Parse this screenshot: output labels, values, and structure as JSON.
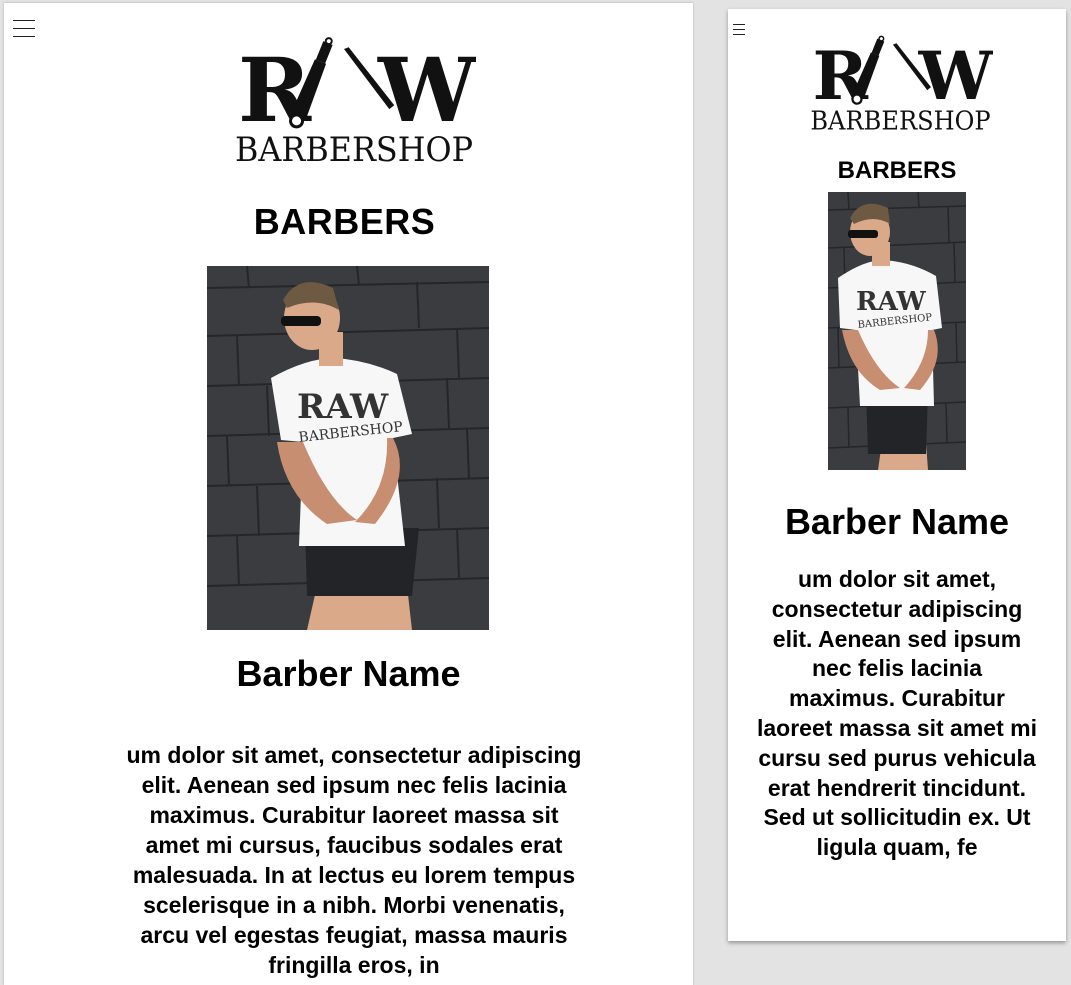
{
  "large_view": {
    "logo": {
      "text_main": "RAW",
      "text_sub": "BARBERSHOP"
    },
    "section_title": "BARBERS",
    "barber": {
      "name": "Barber Name",
      "bio": "um dolor sit amet, consectetur adipiscing elit. Aenean sed ipsum nec felis lacinia maximus. Curabitur laoreet massa sit amet mi cursus, faucibus sodales erat malesuada. In at lectus eu lorem tempus scelerisque in a nibh. Morbi venenatis, arcu vel egestas feugiat, massa mauris fringilla eros, in",
      "photo_shirt_text_main": "RAW",
      "photo_shirt_text_sub": "BARBERSHOP"
    },
    "menu_icon": "hamburger-menu-icon"
  },
  "small_view": {
    "logo": {
      "text_main": "RAW",
      "text_sub": "BARBERSHOP"
    },
    "section_title": "BARBERS",
    "barber": {
      "name": "Barber Name",
      "bio": "um dolor sit amet, consectetur adipiscing elit. Aenean sed ipsum nec felis lacinia maximus. Curabitur laoreet massa sit amet mi cursu sed purus vehicula erat hendrerit tincidunt. Sed ut sollicitudin ex. Ut ligula quam, fe",
      "photo_shirt_text_main": "RAW",
      "photo_shirt_text_sub": "BARBERSHOP"
    },
    "menu_icon": "hamburger-menu-icon"
  },
  "colors": {
    "background": "#e3e3e3",
    "page": "#ffffff",
    "text": "#000000",
    "wall": "#3a3c40"
  }
}
